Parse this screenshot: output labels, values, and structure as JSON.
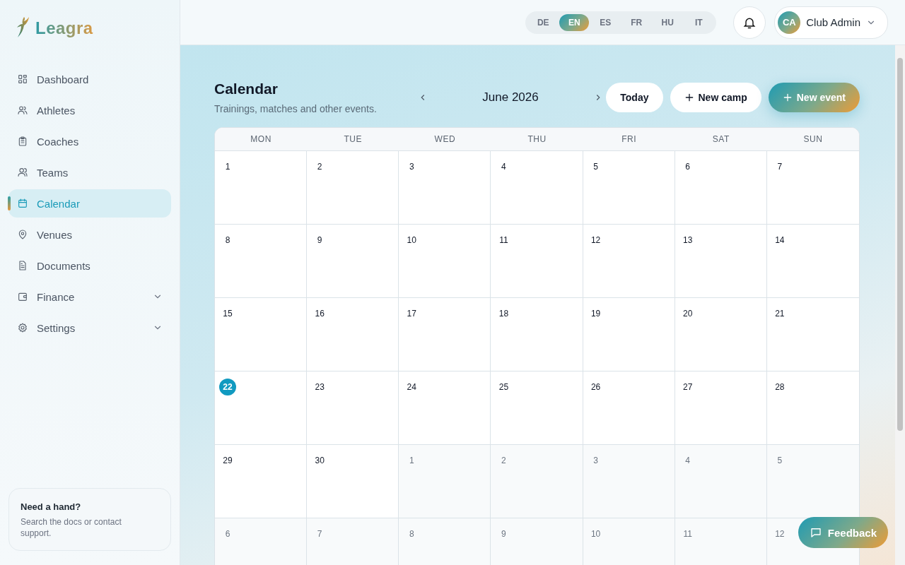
{
  "brand": {
    "name": "Leagra"
  },
  "sidebar": {
    "items": [
      {
        "label": "Dashboard",
        "selected": false
      },
      {
        "label": "Athletes",
        "selected": false
      },
      {
        "label": "Coaches",
        "selected": false
      },
      {
        "label": "Teams",
        "selected": false
      },
      {
        "label": "Calendar",
        "selected": true
      },
      {
        "label": "Venues",
        "selected": false
      },
      {
        "label": "Documents",
        "selected": false
      },
      {
        "label": "Finance",
        "selected": false,
        "expandable": true
      },
      {
        "label": "Settings",
        "selected": false,
        "expandable": true
      }
    ],
    "help": {
      "title": "Need a hand?",
      "text": "Search the docs or contact support."
    }
  },
  "languages": [
    {
      "label": "DE",
      "selected": false
    },
    {
      "label": "EN",
      "selected": true
    },
    {
      "label": "ES",
      "selected": false
    },
    {
      "label": "FR",
      "selected": false
    },
    {
      "label": "HU",
      "selected": false
    },
    {
      "label": "IT",
      "selected": false
    }
  ],
  "user": {
    "initials": "CA",
    "name": "Club Admin"
  },
  "page": {
    "title": "Calendar",
    "subtitle": "Trainings, matches and other events.",
    "month": "June 2026"
  },
  "actions": [
    {
      "label": "Today",
      "kind": "plain"
    },
    {
      "label": "New camp",
      "kind": "outline"
    },
    {
      "label": "New event",
      "kind": "primary"
    }
  ],
  "calendar": {
    "weekdays": [
      "MON",
      "TUE",
      "WED",
      "THU",
      "FRI",
      "SAT",
      "SUN"
    ],
    "weeks": [
      [
        {
          "day": "1",
          "in_month": true,
          "today": false
        },
        {
          "day": "2",
          "in_month": true,
          "today": false
        },
        {
          "day": "3",
          "in_month": true,
          "today": false
        },
        {
          "day": "4",
          "in_month": true,
          "today": false
        },
        {
          "day": "5",
          "in_month": true,
          "today": false
        },
        {
          "day": "6",
          "in_month": true,
          "today": false
        },
        {
          "day": "7",
          "in_month": true,
          "today": false
        }
      ],
      [
        {
          "day": "8",
          "in_month": true,
          "today": false
        },
        {
          "day": "9",
          "in_month": true,
          "today": false
        },
        {
          "day": "10",
          "in_month": true,
          "today": false
        },
        {
          "day": "11",
          "in_month": true,
          "today": false
        },
        {
          "day": "12",
          "in_month": true,
          "today": false
        },
        {
          "day": "13",
          "in_month": true,
          "today": false
        },
        {
          "day": "14",
          "in_month": true,
          "today": false
        }
      ],
      [
        {
          "day": "15",
          "in_month": true,
          "today": false
        },
        {
          "day": "16",
          "in_month": true,
          "today": false
        },
        {
          "day": "17",
          "in_month": true,
          "today": false
        },
        {
          "day": "18",
          "in_month": true,
          "today": false
        },
        {
          "day": "19",
          "in_month": true,
          "today": false
        },
        {
          "day": "20",
          "in_month": true,
          "today": false
        },
        {
          "day": "21",
          "in_month": true,
          "today": false
        }
      ],
      [
        {
          "day": "22",
          "in_month": true,
          "today": true
        },
        {
          "day": "23",
          "in_month": true,
          "today": false
        },
        {
          "day": "24",
          "in_month": true,
          "today": false
        },
        {
          "day": "25",
          "in_month": true,
          "today": false
        },
        {
          "day": "26",
          "in_month": true,
          "today": false
        },
        {
          "day": "27",
          "in_month": true,
          "today": false
        },
        {
          "day": "28",
          "in_month": true,
          "today": false
        }
      ],
      [
        {
          "day": "29",
          "in_month": true,
          "today": false
        },
        {
          "day": "30",
          "in_month": true,
          "today": false
        },
        {
          "day": "1",
          "in_month": false,
          "today": false
        },
        {
          "day": "2",
          "in_month": false,
          "today": false
        },
        {
          "day": "3",
          "in_month": false,
          "today": false
        },
        {
          "day": "4",
          "in_month": false,
          "today": false
        },
        {
          "day": "5",
          "in_month": false,
          "today": false
        }
      ],
      [
        {
          "day": "6",
          "in_month": false,
          "today": false
        },
        {
          "day": "7",
          "in_month": false,
          "today": false
        },
        {
          "day": "8",
          "in_month": false,
          "today": false
        },
        {
          "day": "9",
          "in_month": false,
          "today": false
        },
        {
          "day": "10",
          "in_month": false,
          "today": false
        },
        {
          "day": "11",
          "in_month": false,
          "today": false
        },
        {
          "day": "12",
          "in_month": false,
          "today": false
        }
      ]
    ]
  },
  "feedback": {
    "label": "Feedback"
  }
}
